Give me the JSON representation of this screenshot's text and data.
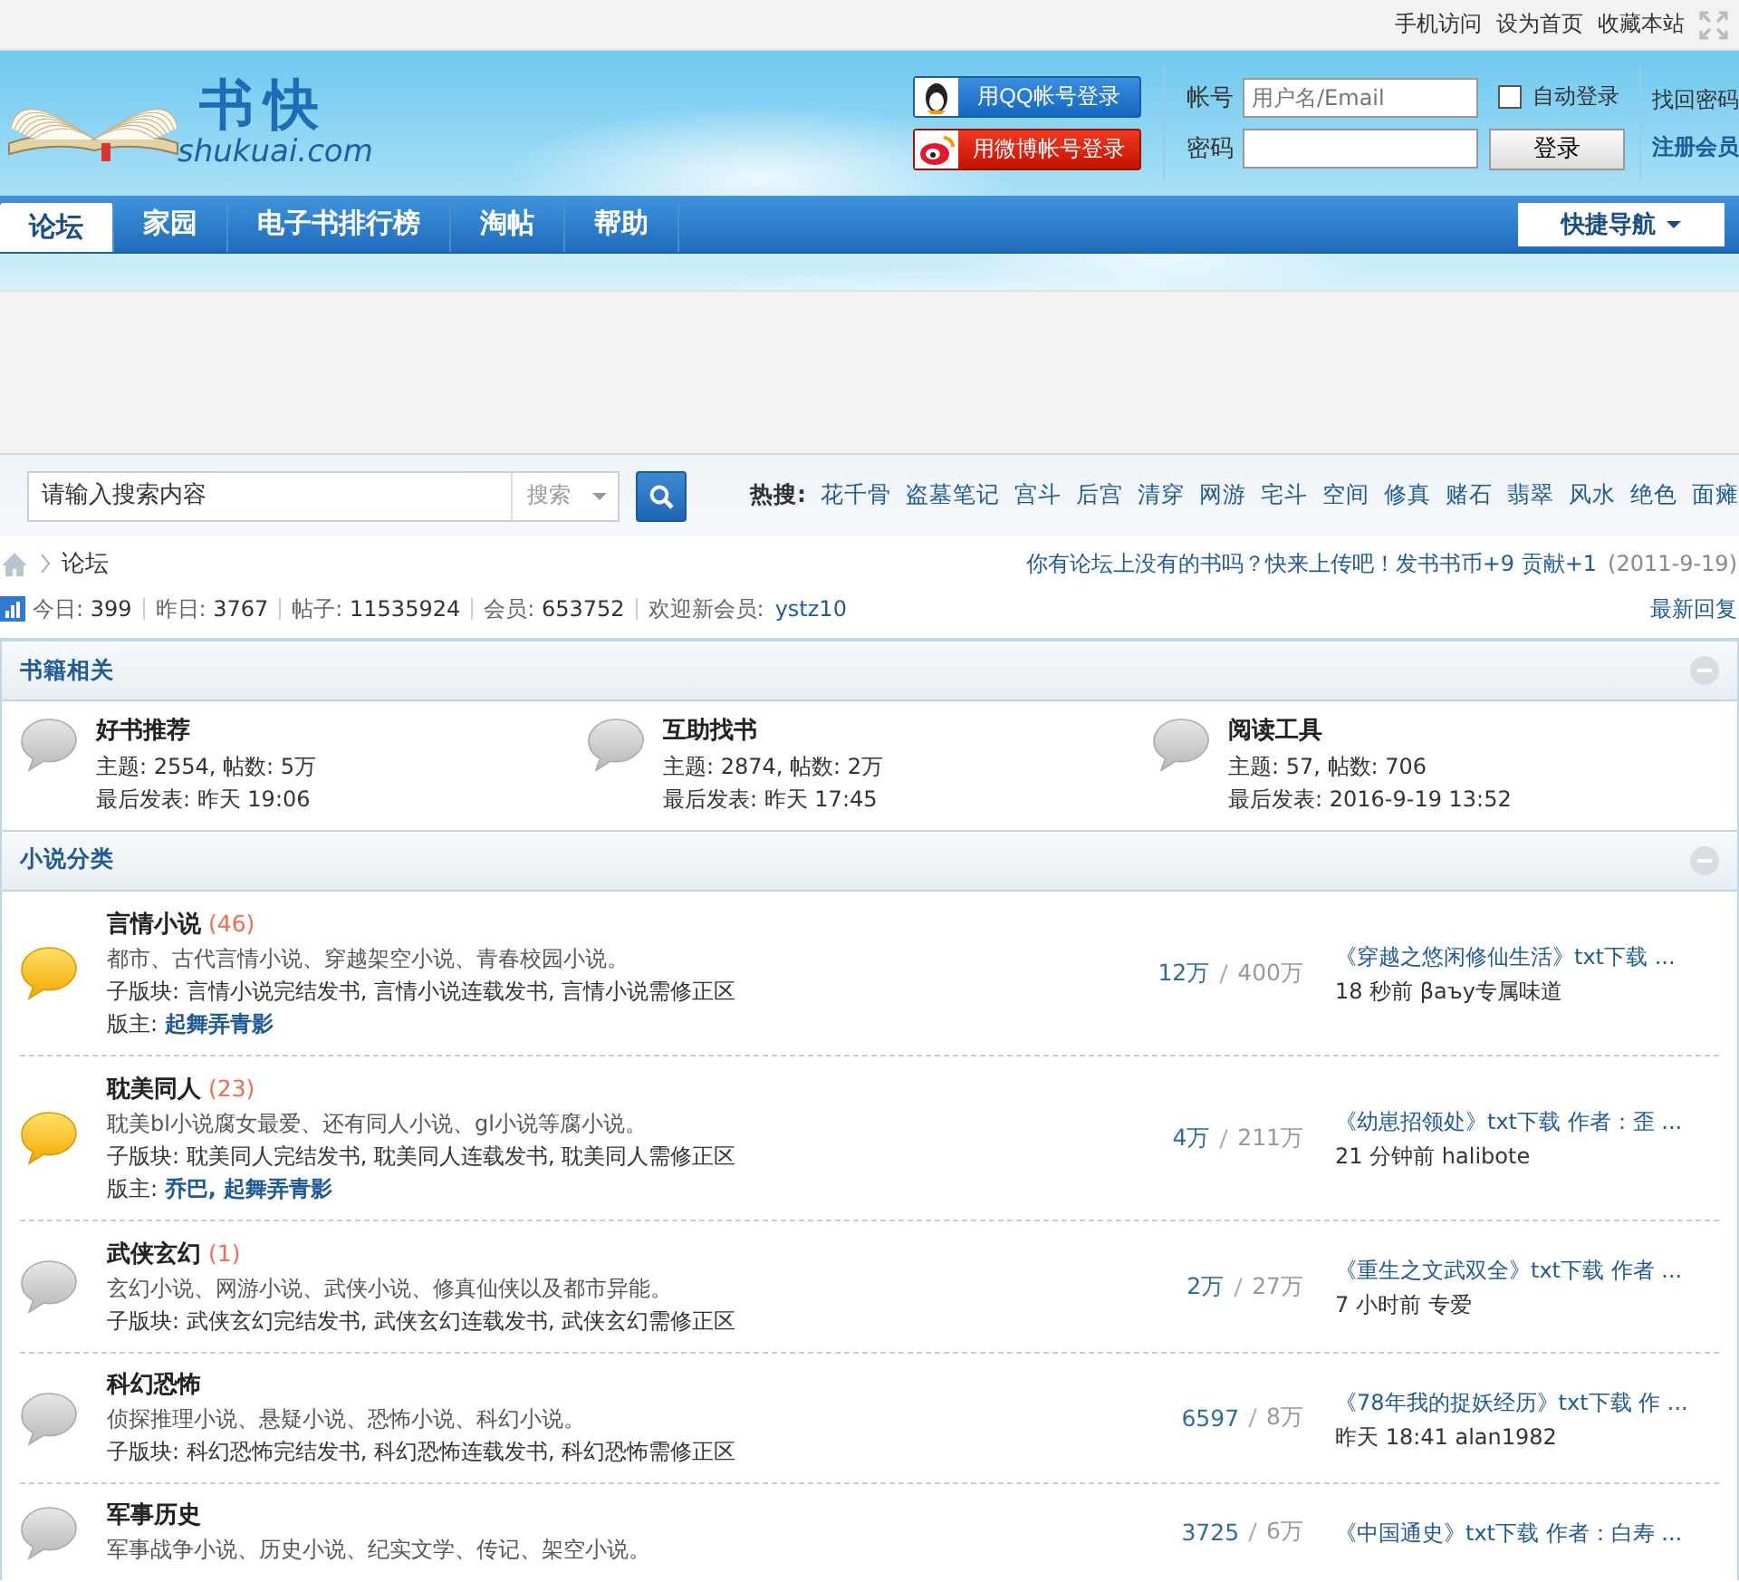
{
  "top_links": [
    "手机访问",
    "设为首页",
    "收藏本站"
  ],
  "logo": {
    "title": "书快",
    "subtitle": "shukuai.com"
  },
  "social_login": [
    {
      "kind": "qq",
      "label": "用QQ帐号登录"
    },
    {
      "kind": "weibo",
      "label": "用微博帐号登录"
    }
  ],
  "login": {
    "account_label": "帐号",
    "account_placeholder": "用户名/Email",
    "password_label": "密码",
    "auto_login": {
      "label": "自动登录",
      "checked": false
    },
    "submit": "登录",
    "links": [
      "找回密码",
      "注册会员"
    ]
  },
  "nav": {
    "tabs": [
      {
        "label": "论坛",
        "selected": true
      },
      {
        "label": "家园",
        "selected": false
      },
      {
        "label": "电子书排行榜",
        "selected": false
      },
      {
        "label": "淘帖",
        "selected": false
      },
      {
        "label": "帮助",
        "selected": false
      }
    ],
    "quick_nav": "快捷导航"
  },
  "search": {
    "placeholder": "请输入搜索内容",
    "scope": "搜索",
    "hot_label": "热搜:",
    "hot_terms": [
      "花千骨",
      "盗墓笔记",
      "宫斗",
      "后宫",
      "清穿",
      "网游",
      "宅斗",
      "空间",
      "修真",
      "赌石",
      "翡翠",
      "风水",
      "绝色",
      "面瘫"
    ]
  },
  "breadcrumb": [
    "论坛"
  ],
  "notice": {
    "text": "你有论坛上没有的书吗？快来上传吧！发书书币+9 贡献+1",
    "date": "(2011-9-19)"
  },
  "stats": [
    {
      "label": "今日:",
      "value": "399"
    },
    {
      "label": "昨日:",
      "value": "3767"
    },
    {
      "label": "帖子:",
      "value": "11535924"
    },
    {
      "label": "会员:",
      "value": "653752"
    }
  ],
  "newest_member": {
    "label": "欢迎新会员:",
    "name": "ystz10"
  },
  "latest_replies": "最新回复",
  "sections": [
    {
      "title": "书籍相关",
      "kind": "grid",
      "forums": [
        {
          "name": "好书推荐",
          "new": false,
          "stats": "主题: 2554, 帖数: 5万",
          "last": "最后发表: 昨天 19:06"
        },
        {
          "name": "互助找书",
          "new": false,
          "stats": "主题: 2874, 帖数: 2万",
          "last": "最后发表: 昨天 17:45"
        },
        {
          "name": "阅读工具",
          "new": false,
          "stats": "主题: 57, 帖数: 706",
          "last": "最后发表: 2016-9-19 13:52"
        }
      ]
    },
    {
      "title": "小说分类",
      "kind": "list",
      "forums": [
        {
          "name": "言情小说",
          "new": true,
          "count": "(46)",
          "description": "都市、古代言情小说、穿越架空小说、青春校园小说。",
          "subforums": "子版块: 言情小说完结发书, 言情小说连载发书, 言情小说需修正区",
          "moderators_label": "版主:",
          "moderators": "起舞弄青影",
          "threads": "12万",
          "posts": "400万",
          "last_title": "《穿越之悠闲修仙生活》txt下载 ...",
          "last_meta": "18 秒前 βаъу专属味道"
        },
        {
          "name": "耽美同人",
          "new": true,
          "count": "(23)",
          "description": "耽美bl小说腐女最爱、还有同人小说、gl小说等腐小说。",
          "subforums": "子版块: 耽美同人完结发书, 耽美同人连载发书, 耽美同人需修正区",
          "moderators_label": "版主:",
          "moderators": "乔巴, 起舞弄青影",
          "threads": "4万",
          "posts": "211万",
          "last_title": "《幼崽招领处》txt下载  作者：歪 ...",
          "last_meta": "21 分钟前  halibote"
        },
        {
          "name": "武侠玄幻",
          "new": false,
          "count": "(1)",
          "description": "玄幻小说、网游小说、武侠小说、修真仙侠以及都市异能。",
          "subforums": "子版块: 武侠玄幻完结发书, 武侠玄幻连载发书, 武侠玄幻需修正区",
          "threads": "2万",
          "posts": "27万",
          "last_title": "《重生之文武双全》txt下载  作者 ...",
          "last_meta": "7 小时前  专爱"
        },
        {
          "name": "科幻恐怖",
          "new": false,
          "description": "侦探推理小说、悬疑小说、恐怖小说、科幻小说。",
          "subforums": "子版块: 科幻恐怖完结发书, 科幻恐怖连载发书, 科幻恐怖需修正区",
          "threads": "6597",
          "posts": "8万",
          "last_title": "《78年我的捉妖经历》txt下载  作 ...",
          "last_meta": "昨天 18:41 alan1982"
        },
        {
          "name": "军事历史",
          "new": false,
          "description": "军事战争小说、历史小说、纪实文学、传记、架空小说。",
          "threads": "3725",
          "posts": "6万",
          "last_title": "《中国通史》txt下载  作者：白寿 ..."
        }
      ]
    }
  ]
}
